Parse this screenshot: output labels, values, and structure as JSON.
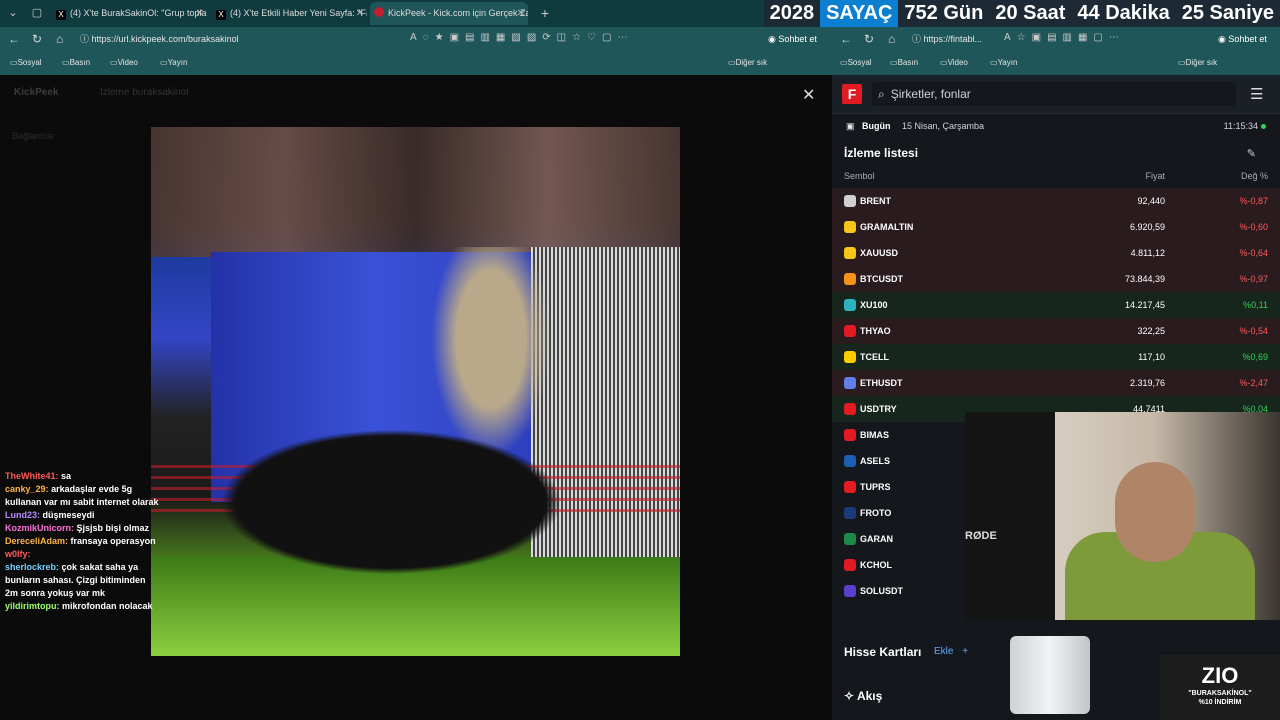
{
  "browser": {
    "tabs": [
      {
        "title": "(4) X'te BurakSakinOl: \"Grup topla",
        "active": false
      },
      {
        "title": "(4) X'te Etkili Haber Yeni Sayfa: \"Fa",
        "active": false
      },
      {
        "title": "KickPeek - Kick.com için Gerçek Za",
        "active": true
      }
    ],
    "counter": {
      "year": "2028",
      "label": "SAYAÇ",
      "days": "752 Gün",
      "hours": "20 Saat",
      "minutes": "44 Dakika",
      "seconds": "25 Saniye"
    },
    "left_url": "https://url.kickpeek.com/buraksakinol",
    "right_url": "https://fintabl...",
    "chat_button": "Sohbet et",
    "bookmarks": [
      "Sosyal",
      "Basın",
      "Video",
      "Yayın"
    ],
    "other_bookmarks": "Diğer sık kullanılanlar"
  },
  "kickpeek": {
    "app_name": "KickPeek",
    "watching_label": "İzleme",
    "channel": "buraksakinol",
    "connections_label": "Bağlantılar"
  },
  "chat": [
    {
      "user": "TheWhite41:",
      "text": "sa",
      "color": "u"
    },
    {
      "user": "canky_29:",
      "text": "arkadaşlar evde 5g kullanan var mı sabit internet olarak",
      "color": "u2"
    },
    {
      "user": "Lund23:",
      "text": "düşmeseydi",
      "color": "u3"
    },
    {
      "user": "KozmikUnicorn:",
      "text": "Şjsjsb bişi olmaz",
      "color": "u4"
    },
    {
      "user": "DereceliAdam:",
      "text": "fransaya operasyon",
      "color": "u2"
    },
    {
      "user": "w0lfy:",
      "text": "",
      "color": "u"
    },
    {
      "user": "sherlockreb:",
      "text": "çok sakat saha ya bunların sahası. Çizgi bitiminden 2m sonra yokuş var mk",
      "color": "u5"
    },
    {
      "user": "yildirimtopu:",
      "text": "mikrofondan nolacak",
      "color": "u6"
    }
  ],
  "fintables": {
    "search_placeholder": "Şirketler, fonlar",
    "today_label": "Bugün",
    "date": "15 Nisan, Çarşamba",
    "time": "11:15:34",
    "watchlist_title": "İzleme listesi",
    "col_symbol": "Sembol",
    "col_price": "Fiyat",
    "col_change": "Değ %",
    "rows": [
      {
        "sym": "BRENT",
        "price": "92,440",
        "chg": "%-0,87",
        "dir": "neg",
        "icon": "#d0d0d0"
      },
      {
        "sym": "GRAMALTIN",
        "price": "6.920,59",
        "chg": "%-0,60",
        "dir": "neg",
        "icon": "#f5c518"
      },
      {
        "sym": "XAUUSD",
        "price": "4.811,12",
        "chg": "%-0,64",
        "dir": "neg",
        "icon": "#f5c518"
      },
      {
        "sym": "BTCUSDT",
        "price": "73.844,39",
        "chg": "%-0,97",
        "dir": "neg",
        "icon": "#f7931a"
      },
      {
        "sym": "XU100",
        "price": "14.217,45",
        "chg": "%0,11",
        "dir": "pos",
        "icon": "#2bb3c0"
      },
      {
        "sym": "THYAO",
        "price": "322,25",
        "chg": "%-0,54",
        "dir": "neg",
        "icon": "#e21b22"
      },
      {
        "sym": "TCELL",
        "price": "117,10",
        "chg": "%0,69",
        "dir": "pos",
        "icon": "#ffcc00"
      },
      {
        "sym": "ETHUSDT",
        "price": "2.319,76",
        "chg": "%-2,47",
        "dir": "neg",
        "icon": "#627eea"
      },
      {
        "sym": "USDTRY",
        "price": "44,7411",
        "chg": "%0,04",
        "dir": "pos",
        "icon": "#e21b22"
      },
      {
        "sym": "BIMAS",
        "price": "",
        "chg": "",
        "dir": "",
        "icon": "#e21b22"
      },
      {
        "sym": "ASELS",
        "price": "",
        "chg": "",
        "dir": "",
        "icon": "#1a5fb4"
      },
      {
        "sym": "TUPRS",
        "price": "",
        "chg": "",
        "dir": "",
        "icon": "#e21b22"
      },
      {
        "sym": "FROTO",
        "price": "",
        "chg": "",
        "dir": "",
        "icon": "#1a3a7a"
      },
      {
        "sym": "GARAN",
        "price": "",
        "chg": "",
        "dir": "",
        "icon": "#1e8a4a"
      },
      {
        "sym": "KCHOL",
        "price": "",
        "chg": "",
        "dir": "",
        "icon": "#e21b22"
      },
      {
        "sym": "SOLUSDT",
        "price": "",
        "chg": "",
        "dir": "",
        "icon": "#5b3fd1"
      }
    ],
    "stock_cards": "Hisse Kartları",
    "add_label": "Ekle",
    "feed": "Akış"
  },
  "webcam": {
    "mic_brand": "RØDE"
  },
  "promo": {
    "logo": "ZIO",
    "line1": "\"BURAKSAKİNOL\"",
    "line2": "%10 İNDİRİM"
  }
}
